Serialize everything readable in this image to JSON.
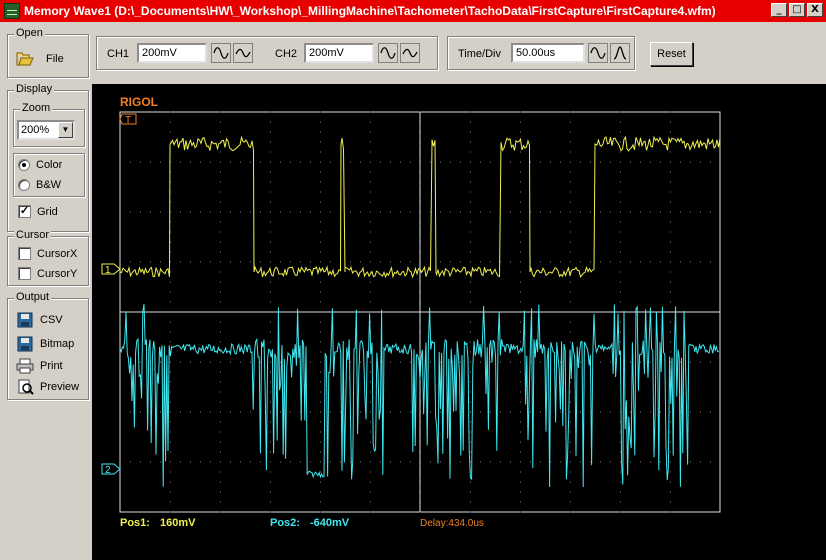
{
  "window": {
    "title": "Memory Wave1  (D:\\_Documents\\HW\\_Workshop\\_MillingMachine\\Tachometer\\TachoData\\FirstCapture\\FirstCapture4.wfm)",
    "minimize": "_",
    "maximize": "□",
    "close": "X"
  },
  "open_group": {
    "title": "Open",
    "file_label": "File"
  },
  "display_group": {
    "title": "Display",
    "zoom_title": "Zoom",
    "zoom_value": "200%",
    "color_label": "Color",
    "bw_label": "B&W",
    "color_selected": true,
    "grid_label": "Grid",
    "grid_checked": true
  },
  "cursor_group": {
    "title": "Cursor",
    "cursorx_label": "CursorX",
    "cursory_label": "CursorY"
  },
  "output_group": {
    "title": "Output",
    "csv_label": "CSV",
    "bitmap_label": "Bitmap",
    "print_label": "Print",
    "preview_label": "Preview"
  },
  "toolbar": {
    "ch1_label": "CH1",
    "ch1_value": "200mV",
    "ch2_label": "CH2",
    "ch2_value": "200mV",
    "timediv_label": "Time/Div",
    "timediv_value": "50.00us",
    "reset_label": "Reset"
  },
  "scope": {
    "brand": "RIGOL",
    "trigger_marker": "T",
    "ch1_marker": "1",
    "ch2_marker": "2",
    "pos1_label": "Pos1:",
    "pos1_value": "160mV",
    "pos2_label": "Pos2:",
    "pos2_value": "-640mV",
    "delay_text": "Delay:434.0us"
  },
  "colors": {
    "ch1": "#f0f050",
    "ch2": "#40e8f0",
    "brand": "#f08020",
    "title_bar": "#e80000",
    "delay": "#f08020"
  }
}
